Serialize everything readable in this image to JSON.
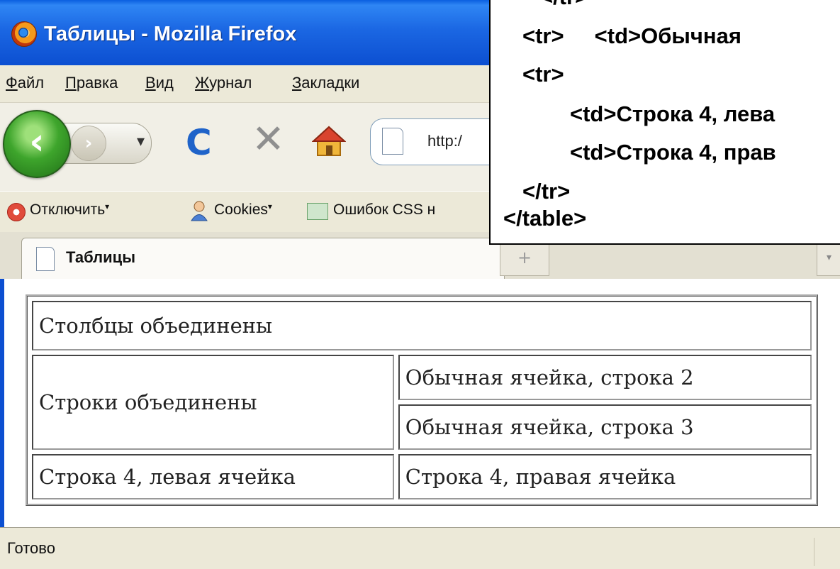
{
  "window": {
    "title": "Таблицы - Mozilla Firefox"
  },
  "menu": {
    "items": [
      "Файл",
      "Правка",
      "Вид",
      "Журнал",
      "Закладки"
    ]
  },
  "nav": {
    "url": "http:/",
    "back": "‹",
    "forward": "›"
  },
  "bookmarks": {
    "items": [
      "Отключить",
      "Cookies",
      "Ошибок CSS н"
    ]
  },
  "tab": {
    "label": "Таблицы"
  },
  "table": {
    "colspan_cell": "Столбцы объединены",
    "rowspan_cell": "Строки объединены",
    "row2_right": "Обычная ячейка, строка 2",
    "row3_right": "Обычная ячейка, строка 3",
    "row4_left": "Строка 4, левая ячейка",
    "row4_right": "Строка 4, правая ячейка"
  },
  "status": {
    "text": "Готово"
  },
  "code": {
    "lines": [
      "</tr>",
      "<tr>     <td>Обычная",
      "<tr>",
      "<td>Строка 4, лева",
      "<td>Строка 4, прав",
      "</tr>",
      "</table>"
    ]
  },
  "colors": {
    "titlebar": "#0c4fd1",
    "chrome": "#ece9d8",
    "back_button": "#3ea52c",
    "reload": "#1f63c9"
  }
}
